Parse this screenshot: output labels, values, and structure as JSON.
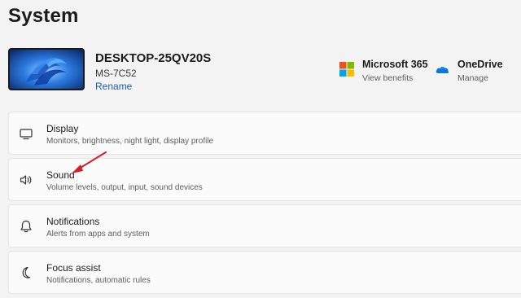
{
  "page": {
    "title": "System"
  },
  "device": {
    "name": "DESKTOP-25QV20S",
    "model": "MS-7C52",
    "rename_label": "Rename"
  },
  "promos": [
    {
      "title": "Microsoft 365",
      "subtitle": "View benefits",
      "icon": "microsoft-logo-icon"
    },
    {
      "title": "OneDrive",
      "subtitle": "Manage",
      "icon": "onedrive-cloud-icon"
    }
  ],
  "settings": [
    {
      "title": "Display",
      "subtitle": "Monitors, brightness, night light, display profile",
      "icon": "monitor-icon"
    },
    {
      "title": "Sound",
      "subtitle": "Volume levels, output, input, sound devices",
      "icon": "speaker-icon"
    },
    {
      "title": "Notifications",
      "subtitle": "Alerts from apps and system",
      "icon": "bell-icon"
    },
    {
      "title": "Focus assist",
      "subtitle": "Notifications, automatic rules",
      "icon": "moon-icon"
    }
  ],
  "colors": {
    "background": "#f3f3f3",
    "card": "#fbfbfb",
    "link": "#1a5fb4",
    "annotation_arrow": "#d0202a"
  }
}
